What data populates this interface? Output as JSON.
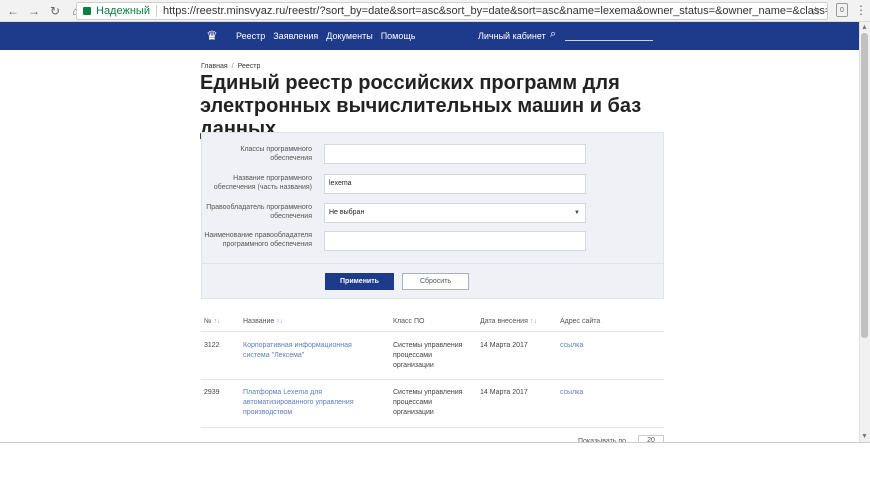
{
  "browser": {
    "secure_label": "Надежный",
    "url": "https://reestr.minsvyaz.ru/reestr/?sort_by=date&sort=asc&sort_by=date&sort=asc&name=lexema&owner_status=&owner_name=&class=&name=lexema&owner_"
  },
  "header": {
    "nav": [
      "Реестр",
      "Заявления",
      "Документы",
      "Помощь"
    ],
    "cabinet": "Личный кабинет",
    "search_placeholder": ""
  },
  "breadcrumb": {
    "home": "Главная",
    "current": "Реестр"
  },
  "page": {
    "title": "Единый реестр российских программ для электронных вычислительных машин и баз данных"
  },
  "filters": {
    "class_label": "Классы программного обеспечения",
    "class_value": "",
    "name_label": "Название программного обеспечения (часть названия)",
    "name_value": "lexema",
    "owner_label": "Правообладатель программного обеспечения",
    "owner_value": "Не выбран",
    "owner_name_label": "Наименование правообладателя программного обеспечения",
    "owner_name_value": "",
    "apply": "Применить",
    "reset": "Сбросить"
  },
  "table": {
    "headers": {
      "num": "№",
      "name": "Название",
      "class": "Класс ПО",
      "date": "Дата внесения",
      "site": "Адрес сайта"
    },
    "sort_arrows": "↑↓",
    "rows": [
      {
        "num": "3122",
        "name": "Корпоративная информационная система \"Лексема\"",
        "class": "Системы управления процессами организации",
        "date": "14 Марта 2017",
        "site": "ссылка"
      },
      {
        "num": "2939",
        "name": "Платформа Lexema для автоматизированного управления производством",
        "class": "Системы управления процессами организации",
        "date": "14 Марта 2017",
        "site": "ссылка"
      }
    ]
  },
  "pagination": {
    "per_page_label": "Показывать по",
    "per_page_value": "20"
  }
}
